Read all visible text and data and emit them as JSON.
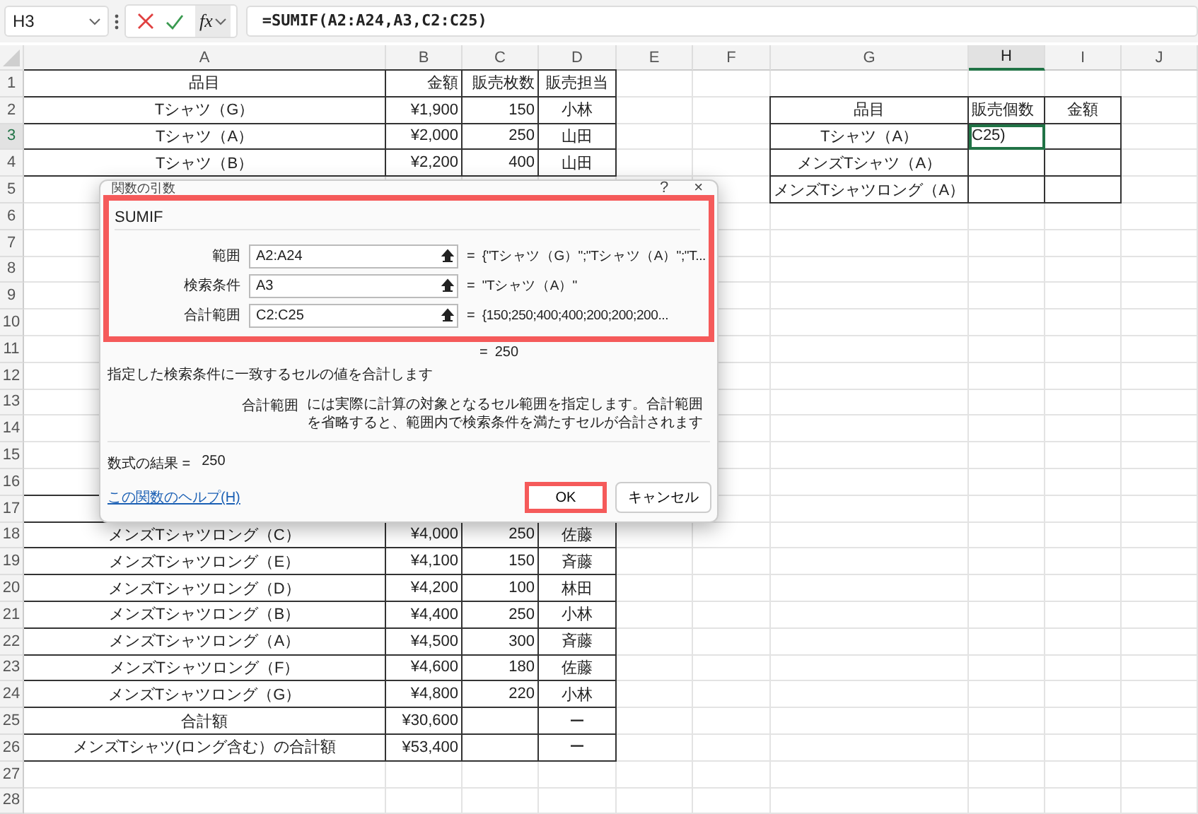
{
  "name_box": "H3",
  "formula_bar": {
    "function_button": "fx",
    "formula": "=SUMIF(A2:A24,A3,C2:C25)"
  },
  "columns": [
    {
      "label": "A",
      "selected": false
    },
    {
      "label": "B",
      "selected": false
    },
    {
      "label": "C",
      "selected": false
    },
    {
      "label": "D",
      "selected": false
    },
    {
      "label": "E",
      "selected": false
    },
    {
      "label": "F",
      "selected": false
    },
    {
      "label": "G",
      "selected": false
    },
    {
      "label": "H",
      "selected": true
    },
    {
      "label": "I",
      "selected": false
    },
    {
      "label": "J",
      "selected": false
    }
  ],
  "rows": [
    {
      "number": "1",
      "selected": false,
      "cells": {
        "A": "品目",
        "B": "金額",
        "C": "販売枚数",
        "D": "販売担当"
      }
    },
    {
      "number": "2",
      "selected": false,
      "cells": {
        "A": "Tシャツ（G）",
        "B": "¥1,900",
        "C": "150",
        "D": "小林",
        "G": "品目",
        "H": "販売個数",
        "I": "金額"
      }
    },
    {
      "number": "3",
      "selected": true,
      "cells": {
        "A": "Tシャツ（A）",
        "B": "¥2,000",
        "C": "250",
        "D": "山田",
        "G": "Tシャツ（A）",
        "H": "C25)"
      }
    },
    {
      "number": "4",
      "selected": false,
      "cells": {
        "A": "Tシャツ（B）",
        "B": "¥2,200",
        "C": "400",
        "D": "山田",
        "G": "メンズTシャツ（A）"
      }
    },
    {
      "number": "5",
      "selected": false,
      "cells": {
        "G": "メンズTシャツロング（A）"
      }
    },
    {
      "number": "6",
      "selected": false,
      "cells": {}
    },
    {
      "number": "7",
      "selected": false,
      "cells": {}
    },
    {
      "number": "8",
      "selected": false,
      "cells": {}
    },
    {
      "number": "9",
      "selected": false,
      "cells": {}
    },
    {
      "number": "10",
      "selected": false,
      "cells": {}
    },
    {
      "number": "11",
      "selected": false,
      "cells": {}
    },
    {
      "number": "12",
      "selected": false,
      "cells": {}
    },
    {
      "number": "13",
      "selected": false,
      "cells": {}
    },
    {
      "number": "14",
      "selected": false,
      "cells": {}
    },
    {
      "number": "15",
      "selected": false,
      "cells": {}
    },
    {
      "number": "16",
      "selected": false,
      "cells": {}
    },
    {
      "number": "17",
      "selected": false,
      "cells": {}
    },
    {
      "number": "18",
      "selected": false,
      "cells": {
        "A": "メンズTシャツロング（C）",
        "B": "¥4,000",
        "C": "250",
        "D": "佐藤"
      }
    },
    {
      "number": "19",
      "selected": false,
      "cells": {
        "A": "メンズTシャツロング（E）",
        "B": "¥4,100",
        "C": "150",
        "D": "斉藤"
      }
    },
    {
      "number": "20",
      "selected": false,
      "cells": {
        "A": "メンズTシャツロング（D）",
        "B": "¥4,200",
        "C": "100",
        "D": "林田"
      }
    },
    {
      "number": "21",
      "selected": false,
      "cells": {
        "A": "メンズTシャツロング（B）",
        "B": "¥4,400",
        "C": "250",
        "D": "小林"
      }
    },
    {
      "number": "22",
      "selected": false,
      "cells": {
        "A": "メンズTシャツロング（A）",
        "B": "¥4,500",
        "C": "300",
        "D": "斉藤"
      }
    },
    {
      "number": "23",
      "selected": false,
      "cells": {
        "A": "メンズTシャツロング（F）",
        "B": "¥4,600",
        "C": "180",
        "D": "佐藤"
      }
    },
    {
      "number": "24",
      "selected": false,
      "cells": {
        "A": "メンズTシャツロング（G）",
        "B": "¥4,800",
        "C": "220",
        "D": "小林"
      }
    },
    {
      "number": "25",
      "selected": false,
      "cells": {
        "A": "合計額",
        "B": "¥30,600",
        "D": "ー"
      }
    },
    {
      "number": "26",
      "selected": false,
      "cells": {
        "A": "メンズTシャツ(ロング含む）の合計額",
        "B": "¥53,400",
        "D": "ー"
      }
    },
    {
      "number": "27",
      "selected": false,
      "cells": {}
    },
    {
      "number": "28",
      "selected": false,
      "cells": {}
    }
  ],
  "dialog": {
    "title": "関数の引数",
    "help": "?",
    "close": "×",
    "function_name": "SUMIF",
    "highlighted": true,
    "arguments": [
      {
        "label": "範囲",
        "value": "A2:A24",
        "equals": "=",
        "result": "{\"Tシャツ（G）\";\"Tシャツ（A）\";\"T..."
      },
      {
        "label": "検索条件",
        "value": "A3",
        "equals": "=",
        "result": "\"Tシャツ（A）\""
      },
      {
        "label": "合計範囲",
        "value": "C2:C25",
        "equals": "=",
        "result": "{150;250;400;400;200;200;200..."
      }
    ],
    "function_result": {
      "equals": "=",
      "value": "250"
    },
    "description": "指定した検索条件に一致するセルの値を合計します",
    "argument_help": {
      "label": "合計範囲",
      "text": "には実際に計算の対象となるセル範囲を指定します。合計範囲を省略すると、範囲内で検索条件を満たすセルが合計されます"
    },
    "formula_result": {
      "label": "数式の結果 =",
      "value": "250"
    },
    "help_link": "この関数のヘルプ(H)",
    "buttons": [
      {
        "label": "OK",
        "highlighted": true
      },
      {
        "label": "キャンセル",
        "highlighted": false
      }
    ]
  }
}
